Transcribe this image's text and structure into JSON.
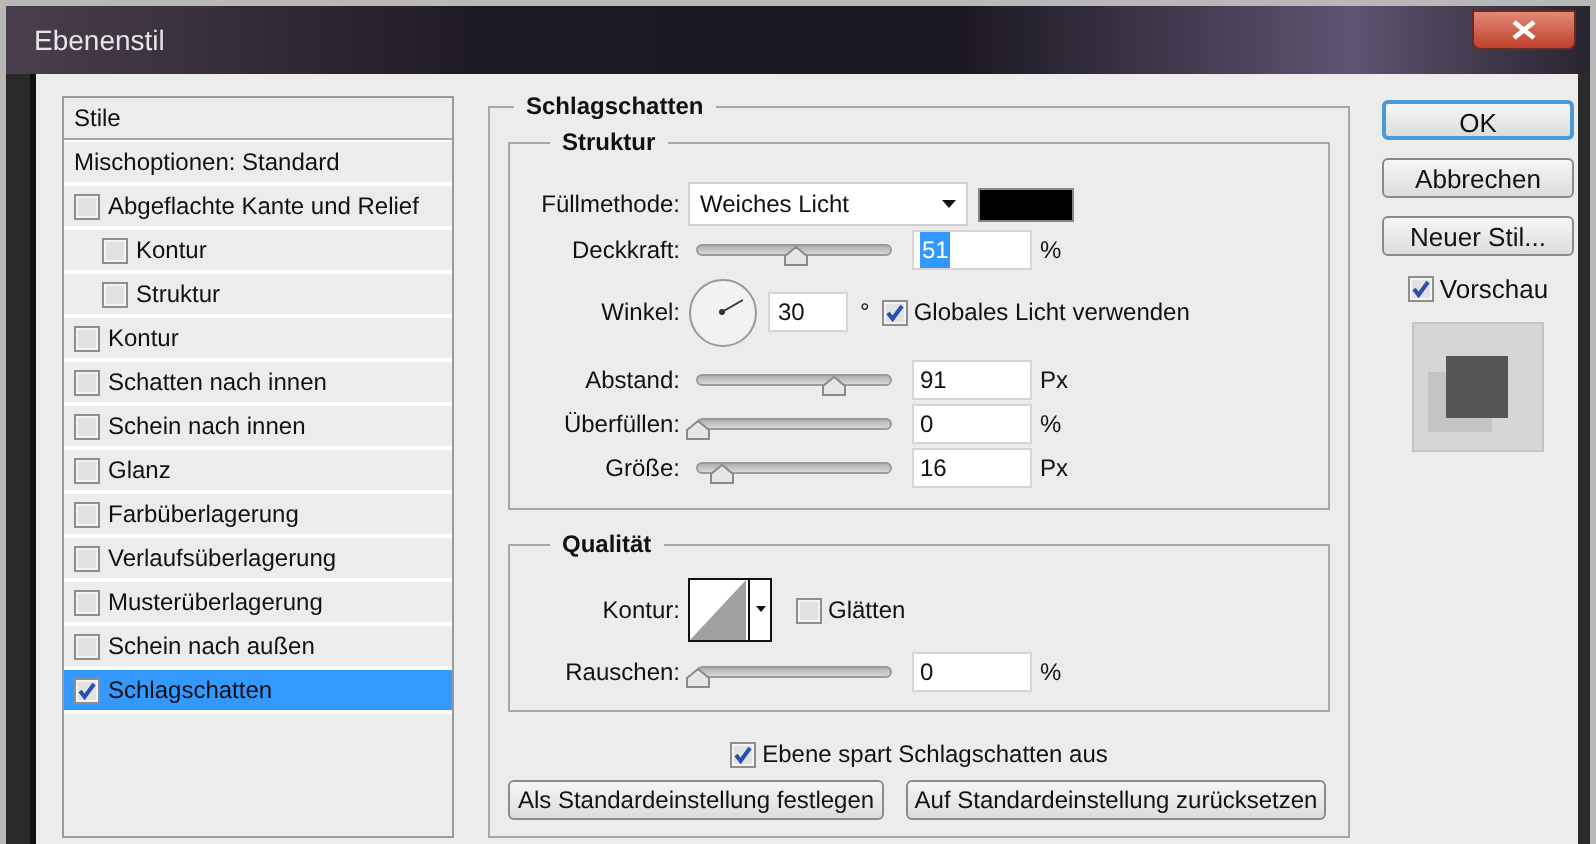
{
  "window": {
    "title": "Ebenenstil"
  },
  "styles_list": {
    "items": [
      {
        "kind": "header",
        "label": "Stile",
        "selected": false
      },
      {
        "kind": "header",
        "label": "Mischoptionen: Standard",
        "selected": false
      },
      {
        "kind": "option",
        "label": "Abgeflachte Kante und Relief",
        "checked": false,
        "selected": false,
        "children": [
          {
            "kind": "option",
            "label": "Kontur",
            "checked": false,
            "selected": false
          },
          {
            "kind": "option",
            "label": "Struktur",
            "checked": false,
            "selected": false
          }
        ]
      },
      {
        "kind": "option",
        "label": "Kontur",
        "checked": false,
        "selected": false
      },
      {
        "kind": "option",
        "label": "Schatten nach innen",
        "checked": false,
        "selected": false
      },
      {
        "kind": "option",
        "label": "Schein nach innen",
        "checked": false,
        "selected": false
      },
      {
        "kind": "option",
        "label": "Glanz",
        "checked": false,
        "selected": false
      },
      {
        "kind": "option",
        "label": "Farbüberlagerung",
        "checked": false,
        "selected": false
      },
      {
        "kind": "option",
        "label": "Verlaufsüberlagerung",
        "checked": false,
        "selected": false
      },
      {
        "kind": "option",
        "label": "Musterüberlagerung",
        "checked": false,
        "selected": false
      },
      {
        "kind": "option",
        "label": "Schein nach außen",
        "checked": false,
        "selected": false
      },
      {
        "kind": "option",
        "label": "Schlagschatten",
        "checked": true,
        "selected": true
      }
    ]
  },
  "effect": {
    "title": "Schlagschatten",
    "structure": {
      "title": "Struktur",
      "rows": [
        {
          "kind": "blend",
          "label": "Füllmethode:",
          "value": "Weiches Licht",
          "color": "#000000"
        },
        {
          "kind": "slider",
          "label": "Deckkraft:",
          "level": 0.51,
          "value": "51",
          "unit": "%",
          "highlighted": true
        },
        {
          "kind": "angle",
          "label": "Winkel:",
          "value": "30",
          "unit": "°",
          "global_light": {
            "label": "Globales Licht verwenden",
            "checked": true
          }
        },
        {
          "kind": "slider",
          "label": "Abstand:",
          "level": 0.71,
          "value": "91",
          "unit": "Px",
          "highlighted": false
        },
        {
          "kind": "slider",
          "label": "Überfüllen:",
          "level": 0,
          "value": "0",
          "unit": "%",
          "highlighted": false
        },
        {
          "kind": "slider",
          "label": "Größe:",
          "level": 0.12,
          "value": "16",
          "unit": "Px",
          "highlighted": false
        }
      ]
    },
    "quality": {
      "title": "Qualität",
      "rows": [
        {
          "kind": "contour",
          "label": "Kontur:",
          "anti_alias": {
            "label": "Glätten",
            "checked": false
          }
        },
        {
          "kind": "slider",
          "label": "Rauschen:",
          "level": 0,
          "value": "0",
          "unit": "%",
          "highlighted": false
        }
      ]
    },
    "knockout": {
      "label": "Ebene spart Schlagschatten aus",
      "checked": true
    },
    "buttons": [
      "Als Standardeinstellung festlegen",
      "Auf Standardeinstellung zurücksetzen"
    ]
  },
  "actions": [
    {
      "label": "OK",
      "default": true
    },
    {
      "label": "Abbrechen",
      "default": false
    },
    {
      "label": "Neuer Stil...",
      "default": false
    }
  ],
  "preview": {
    "label": "Vorschau",
    "checked": true
  }
}
